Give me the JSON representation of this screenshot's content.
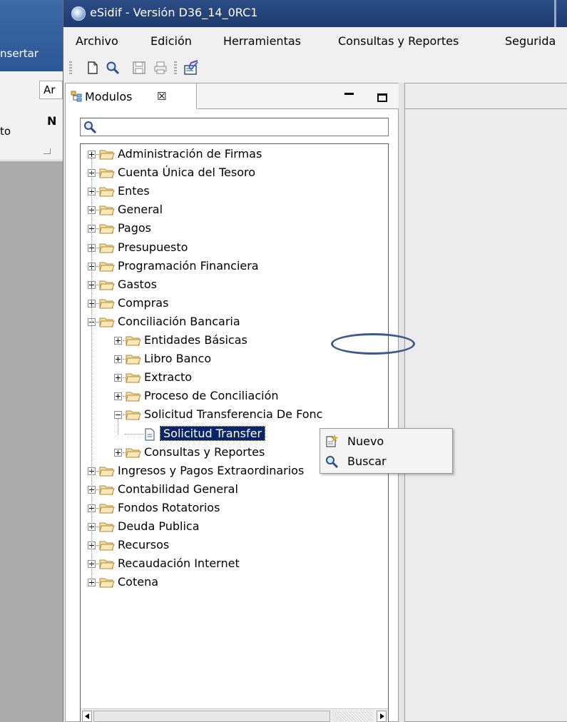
{
  "background_app": {
    "tab_label": "nsertar",
    "font_box": "Ar",
    "bold_button": "N",
    "group_label": "to"
  },
  "window": {
    "title": "eSidif - Versión D36_14_0RC1",
    "icon": "esidif-app-icon"
  },
  "menubar": {
    "items": [
      "Archivo",
      "Edición",
      "Herramientas",
      "Consultas y Reportes",
      "Segurida"
    ]
  },
  "toolbar": {
    "buttons": [
      "new-document-icon",
      "search-icon",
      "save-icon",
      "print-icon",
      "edit-form-icon"
    ]
  },
  "modulos_view": {
    "tab_label": "Modulos",
    "tab_close": "☒",
    "filter_value": "",
    "tree": [
      {
        "label": "Administración de Firmas",
        "expanded": false
      },
      {
        "label": "Cuenta Única del Tesoro",
        "expanded": false
      },
      {
        "label": "Entes",
        "expanded": false
      },
      {
        "label": "General",
        "expanded": false
      },
      {
        "label": "Pagos",
        "expanded": false
      },
      {
        "label": "Presupuesto",
        "expanded": false
      },
      {
        "label": "Programación Financiera",
        "expanded": false
      },
      {
        "label": "Gastos",
        "expanded": false
      },
      {
        "label": "Compras",
        "expanded": false
      },
      {
        "label": "Conciliación Bancaria",
        "expanded": true,
        "children": [
          {
            "label": "Entidades Básicas",
            "expanded": false
          },
          {
            "label": "Libro Banco",
            "expanded": false
          },
          {
            "label": "Extracto",
            "expanded": false
          },
          {
            "label": "Proceso de Conciliación",
            "expanded": false
          },
          {
            "label": "Solicitud Transferencia De Fonc",
            "expanded": true,
            "children": [
              {
                "label": "Solicitud Transfer",
                "selected": true
              }
            ]
          },
          {
            "label": "Consultas y Reportes",
            "expanded": false
          }
        ]
      },
      {
        "label": "Ingresos y Pagos Extraordinarios",
        "expanded": false
      },
      {
        "label": "Contabilidad General",
        "expanded": false
      },
      {
        "label": "Fondos Rotatorios",
        "expanded": false
      },
      {
        "label": "Deuda Publica",
        "expanded": false
      },
      {
        "label": "Recursos",
        "expanded": false
      },
      {
        "label": "Recaudación Internet",
        "expanded": false
      },
      {
        "label": "Cotena",
        "expanded": false
      }
    ]
  },
  "context_menu": {
    "items": [
      {
        "label": "Nuevo",
        "icon": "new-item-icon"
      },
      {
        "label": "Buscar",
        "icon": "search-icon"
      }
    ]
  },
  "colors": {
    "titlebar": "#1e3a6e",
    "selection": "#0a246a",
    "annotation": "#3c5a8a"
  }
}
